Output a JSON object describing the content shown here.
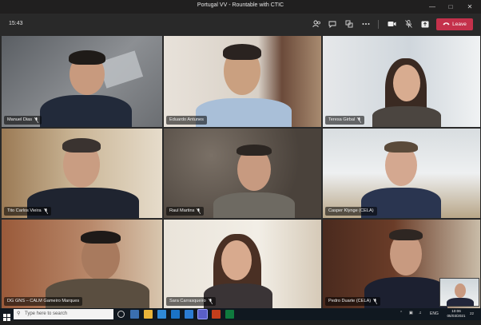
{
  "window": {
    "title": "Portugal VV - Rountable with CTIC"
  },
  "meeting": {
    "time": "15:43",
    "leave_label": "Leave",
    "icons": [
      "people-icon",
      "chat-icon",
      "breakout-icon",
      "more-icon",
      "camera-icon",
      "mic-icon",
      "share-icon"
    ]
  },
  "participants": [
    {
      "name": "Manuel Dias",
      "muted": true
    },
    {
      "name": "Eduardo Antunes",
      "muted": false
    },
    {
      "name": "Teresa Girbal",
      "muted": true
    },
    {
      "name": "Tito Carlos Vieira",
      "muted": true
    },
    {
      "name": "Raul Martins",
      "muted": true
    },
    {
      "name": "Casper Klynge (CELA)",
      "muted": false
    },
    {
      "name": "DG GNS – CALM Gameiro Marques",
      "muted": false
    },
    {
      "name": "Sara Carrasqueiro",
      "muted": true
    },
    {
      "name": "Pedro Duarte (CELA)",
      "muted": true
    }
  ],
  "taskbar": {
    "search_placeholder": "Type here to search",
    "lang": "ENG",
    "clock_time": "10:06",
    "clock_date": "05/03/2021",
    "notif_count": "22"
  }
}
